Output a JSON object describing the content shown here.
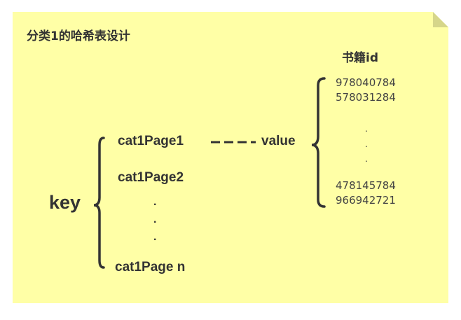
{
  "title": "分类1的哈希表设计",
  "key_label": "key",
  "keys": [
    "cat1Page1",
    "cat1Page2",
    "cat1Page n"
  ],
  "connector_label": "value",
  "value_header": "书籍id",
  "ids_top": [
    "978040784",
    "578031284"
  ],
  "ids_bottom": [
    "478145784",
    "966942721"
  ],
  "ellipsis": ".",
  "colors": {
    "note": "#ffffa6",
    "note_fold": "#d6d68a",
    "text": "#333333"
  }
}
